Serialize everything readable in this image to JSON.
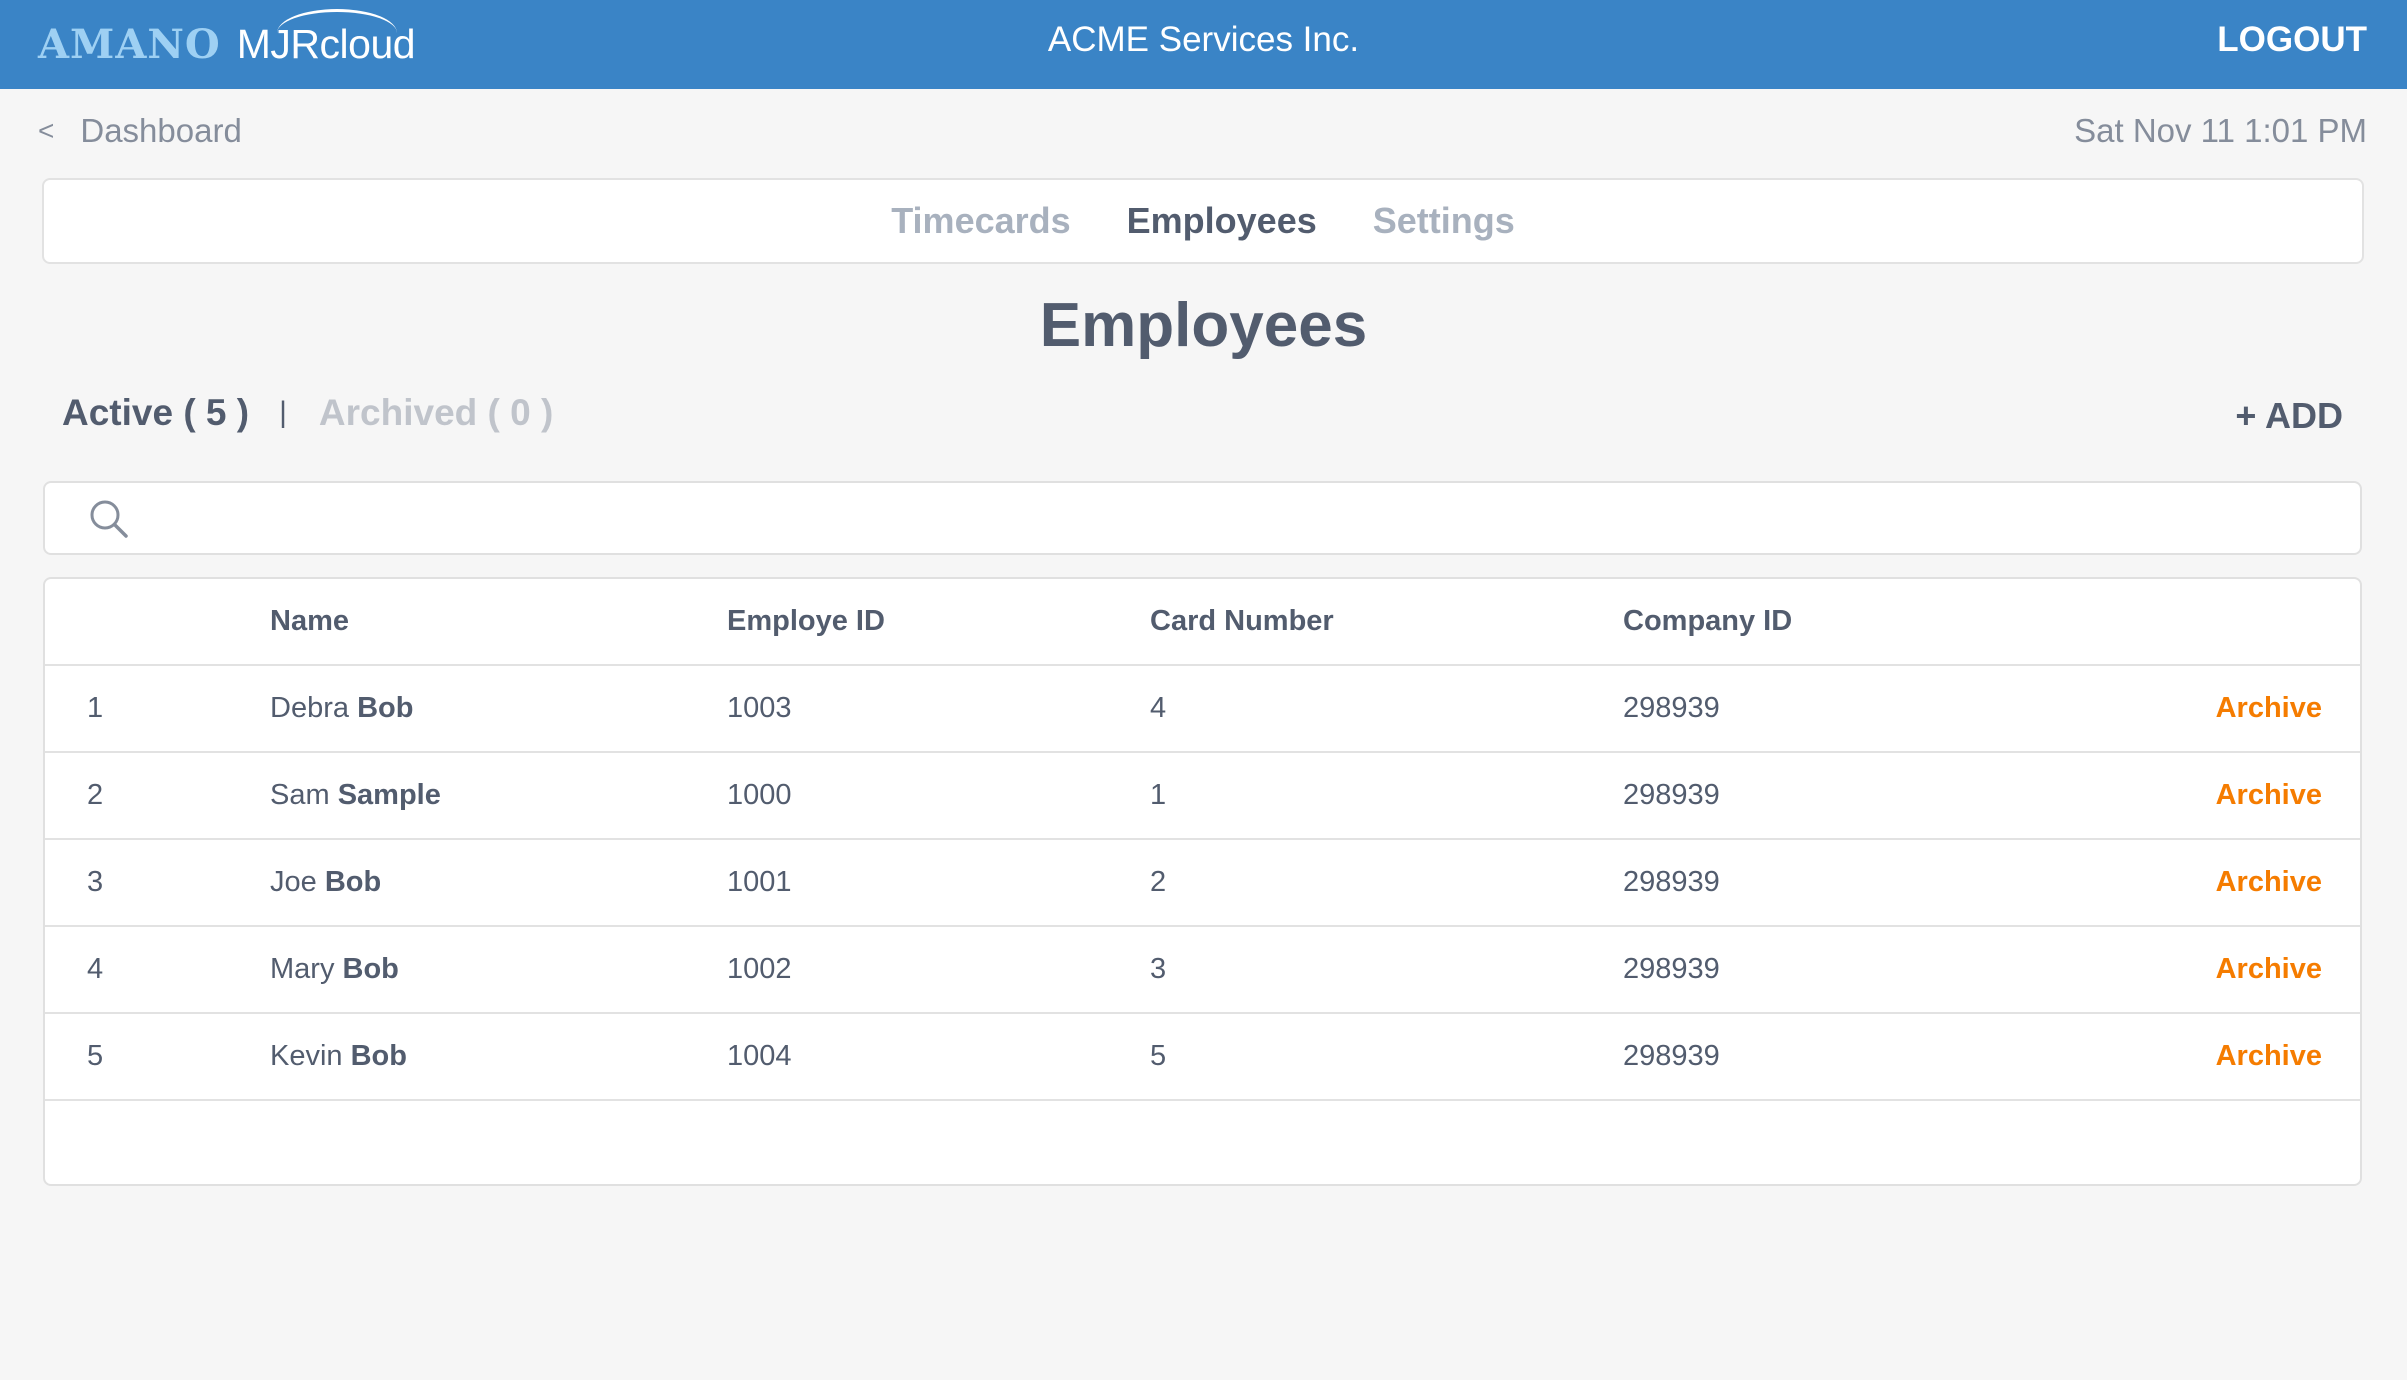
{
  "header": {
    "logo_brand": "AMANO",
    "logo_product": "MJRcloud",
    "company_name": "ACME Services Inc.",
    "logout_label": "LOGOUT"
  },
  "breadcrumb": {
    "back_icon": "chevron-left-icon",
    "chevron": "<",
    "label": "Dashboard"
  },
  "datetime": "Sat Nov 11 1:01 PM",
  "nav": {
    "tabs": [
      {
        "label": "Timecards",
        "active": false
      },
      {
        "label": "Employees",
        "active": true
      },
      {
        "label": "Settings",
        "active": false
      }
    ]
  },
  "page_title": "Employees",
  "filters": {
    "active_label": "Active ( 5 )",
    "separator": "|",
    "archived_label": "Archived ( 0 )"
  },
  "add_button": "+ ADD",
  "search": {
    "icon": "search-icon",
    "value": "",
    "placeholder": ""
  },
  "table": {
    "columns": [
      "",
      "Name",
      "Employe ID",
      "Card Number",
      "Company ID",
      ""
    ],
    "rows": [
      {
        "index": "1",
        "first": "Debra",
        "last": "Bob",
        "employee_id": "1003",
        "card_number": "4",
        "company_id": "298939",
        "action": "Archive"
      },
      {
        "index": "2",
        "first": "Sam",
        "last": "Sample",
        "employee_id": "1000",
        "card_number": "1",
        "company_id": "298939",
        "action": "Archive"
      },
      {
        "index": "3",
        "first": "Joe",
        "last": "Bob",
        "employee_id": "1001",
        "card_number": "2",
        "company_id": "298939",
        "action": "Archive"
      },
      {
        "index": "4",
        "first": "Mary",
        "last": "Bob",
        "employee_id": "1002",
        "card_number": "3",
        "company_id": "298939",
        "action": "Archive"
      },
      {
        "index": "5",
        "first": "Kevin",
        "last": "Bob",
        "employee_id": "1004",
        "card_number": "5",
        "company_id": "298939",
        "action": "Archive"
      }
    ]
  },
  "colors": {
    "header_bg": "#3a84c6",
    "logo_brand": "#9ed0f3",
    "text_primary": "#525c6e",
    "text_muted": "#a8b1be",
    "archive_action": "#f57c00",
    "page_bg": "#f6f6f6"
  }
}
